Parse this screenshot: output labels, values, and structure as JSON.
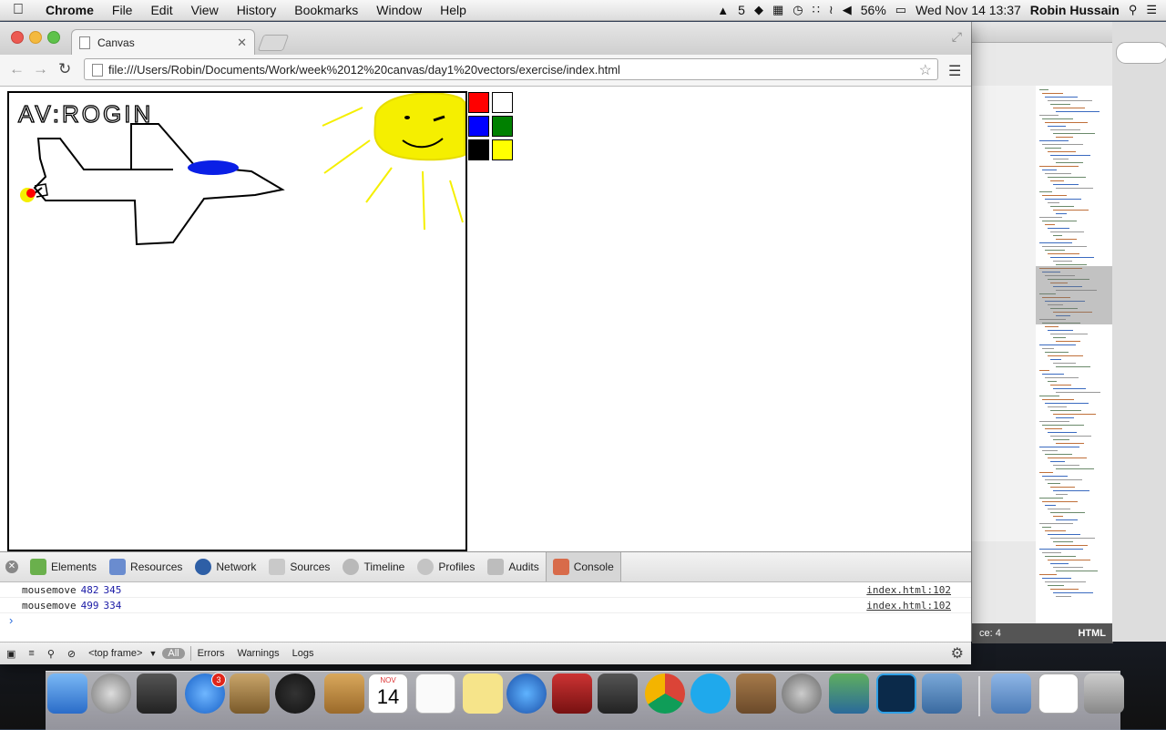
{
  "menubar": {
    "app": "Chrome",
    "items": [
      "File",
      "Edit",
      "View",
      "History",
      "Bookmarks",
      "Window",
      "Help"
    ],
    "status": {
      "adobe_count": "5",
      "battery": "56%",
      "datetime": "Wed Nov 14  13:37",
      "user": "Robin Hussain"
    }
  },
  "browser": {
    "tab_title": "Canvas",
    "url": "file:///Users/Robin/Documents/Work/week%2012%20canvas/day1%20vectors/exercise/index.html"
  },
  "drawing": {
    "author_text": "AV:ROGIN"
  },
  "palette": {
    "colors": [
      "#ff0000",
      "#ffffff",
      "#0000ff",
      "#008000",
      "#000000",
      "#ffff00"
    ]
  },
  "devtools": {
    "tabs": [
      "Elements",
      "Resources",
      "Network",
      "Sources",
      "Timeline",
      "Profiles",
      "Audits",
      "Console"
    ],
    "active_tab": "Console",
    "logs": [
      {
        "label": "mousemove",
        "x": "482",
        "y": "345",
        "source": "index.html:102"
      },
      {
        "label": "mousemove",
        "x": "499",
        "y": "334",
        "source": "index.html:102"
      }
    ],
    "frame_select": "<top frame>",
    "filters": [
      "All",
      "Errors",
      "Warnings",
      "Logs"
    ]
  },
  "editor": {
    "status_left": "ce: 4",
    "status_right": "HTML"
  },
  "dock": {
    "appstore_badge": "3",
    "calendar_month": "NOV",
    "calendar_day": "14"
  }
}
